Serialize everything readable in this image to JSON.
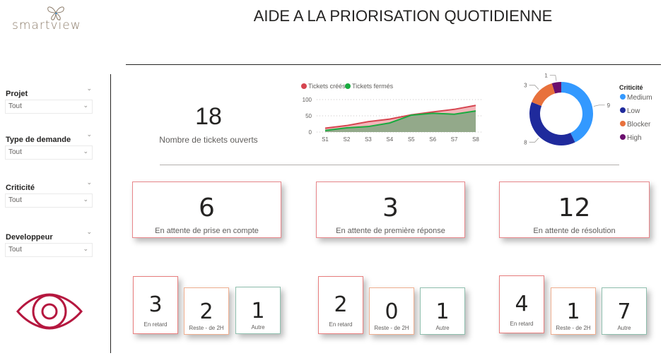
{
  "app": {
    "logo_text": "smartview",
    "title": "AIDE A LA PRIORISATION QUOTIDIENNE"
  },
  "filters": [
    {
      "label": "Projet",
      "value": "Tout"
    },
    {
      "label": "Type de demande",
      "value": "Tout"
    },
    {
      "label": "Criticité",
      "value": "Tout"
    },
    {
      "label": "Developpeur",
      "value": "Tout"
    }
  ],
  "icons": {
    "filter_chevron": "chevron-down-icon",
    "eye": "eye-icon"
  },
  "summary": {
    "value": "18",
    "label": "Nombre de tickets ouverts"
  },
  "colors": {
    "created": "#d64550",
    "closed": "#1aab40",
    "medium": "#3399ff",
    "low": "#1f2a9c",
    "blocker": "#e8713c",
    "high": "#6b0f6e",
    "card_border": "#e8868a",
    "eye": "#b5173f"
  },
  "chart_data": [
    {
      "type": "area",
      "title": "",
      "legend": [
        "Tickets créés",
        "Tickets fermés"
      ],
      "legend_position": "top-left",
      "categories": [
        "S1",
        "S2",
        "S3",
        "S4",
        "S5",
        "S6",
        "S7",
        "S8"
      ],
      "series": [
        {
          "name": "Tickets créés",
          "values": [
            12,
            20,
            32,
            40,
            53,
            62,
            70,
            82
          ]
        },
        {
          "name": "Tickets fermés",
          "values": [
            5,
            13,
            17,
            28,
            52,
            58,
            55,
            65
          ]
        }
      ],
      "yticks": [
        "0",
        "50",
        "100"
      ],
      "ylim": [
        0,
        100
      ],
      "grid": true
    },
    {
      "type": "pie",
      "title": "Criticité",
      "legend_position": "right",
      "labels": [
        "Medium",
        "Low",
        "Blocker",
        "High"
      ],
      "values": [
        9,
        8,
        3,
        1
      ],
      "donut": true
    }
  ],
  "status_cards": [
    {
      "value": "6",
      "label": "En attente de prise en compte",
      "breakdown": [
        {
          "value": "3",
          "label": "En retard"
        },
        {
          "value": "2",
          "label": "Reste - de 2H"
        },
        {
          "value": "1",
          "label": "Autre"
        }
      ]
    },
    {
      "value": "3",
      "label": "En attente de première réponse",
      "breakdown": [
        {
          "value": "2",
          "label": "En retard"
        },
        {
          "value": "0",
          "label": "Reste - de 2H"
        },
        {
          "value": "1",
          "label": "Autre"
        }
      ]
    },
    {
      "value": "12",
      "label": "En attente de résolution",
      "breakdown": [
        {
          "value": "4",
          "label": "En retard"
        },
        {
          "value": "1",
          "label": "Reste - de 2H"
        },
        {
          "value": "7",
          "label": "Autre"
        }
      ]
    }
  ]
}
